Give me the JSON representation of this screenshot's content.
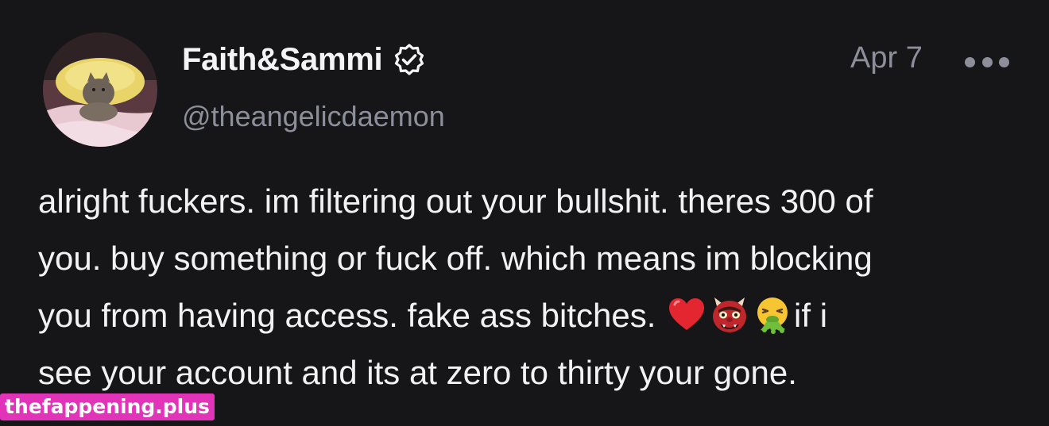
{
  "post": {
    "author": {
      "display_name": "Faith&Sammi",
      "handle": "@theangelicdaemon",
      "verified_icon": "verified-badge-icon",
      "avatar": "cat-photo-avatar"
    },
    "timestamp": "Apr 7",
    "more_icon": "more-horizontal-icon",
    "body": {
      "line1": "alright fuckers. im filtering out your bullshit. theres 300 of",
      "line2": "you. buy something or fuck off. which means im blocking",
      "line3_text": "you from having access. fake ass bitches. ",
      "line3_emojis": [
        "red-heart-emoji",
        "ogre-emoji",
        "vomiting-face-emoji"
      ],
      "line3_tail": "if i",
      "line4": "see your account and its at zero to thirty your gone."
    }
  },
  "watermark": {
    "text": "thefappening.plus",
    "color": "#e234b8"
  },
  "colors": {
    "background": "#161618",
    "primary_text": "#f2f2f4",
    "secondary_text": "#8c8f99"
  }
}
